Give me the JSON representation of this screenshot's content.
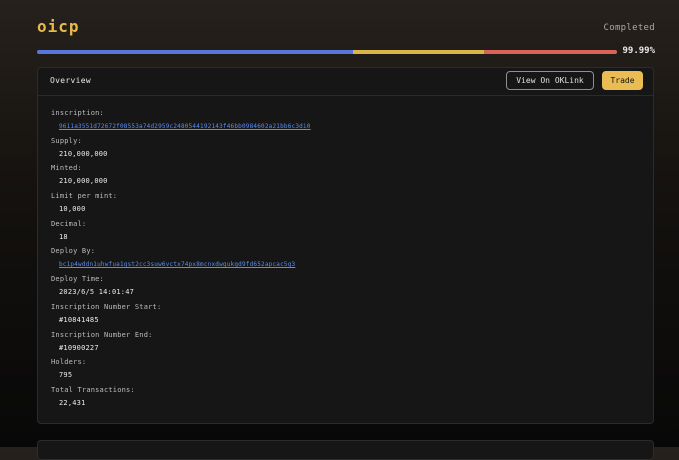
{
  "header": {
    "title": "oicp",
    "status": "Completed",
    "progress_percent": 99.99,
    "progress_label": "99.99%"
  },
  "card": {
    "title": "Overview",
    "oklink_button": "View On OKLink",
    "trade_button": "Trade"
  },
  "fields": [
    {
      "label": "inscription:",
      "value": "9611a3551d72672f08553a74d2959c2480544192143f46bb0984602a21bb6c3di0",
      "link": true
    },
    {
      "label": "Supply:",
      "value": "210,000,000",
      "link": false
    },
    {
      "label": "Minted:",
      "value": "210,000,000",
      "link": false
    },
    {
      "label": "Limit per mint:",
      "value": "10,000",
      "link": false
    },
    {
      "label": "Decimal:",
      "value": "18",
      "link": false
    },
    {
      "label": "Deploy By:",
      "value": "bc1p4wddn1uhwfua1qst2cc3suw6vctx74px8mcnxdwgukgd9fd652apcac5g3",
      "link": true
    },
    {
      "label": "Deploy Time:",
      "value": "2023/6/5 14:01:47",
      "link": false
    },
    {
      "label": "Inscription Number Start:",
      "value": "#10841485",
      "link": false
    },
    {
      "label": "Inscription Number End:",
      "value": "#10900227",
      "link": false
    },
    {
      "label": "Holders:",
      "value": "795",
      "link": false
    },
    {
      "label": "Total Transactions:",
      "value": "22,431",
      "link": false
    }
  ],
  "colors": {
    "accent": "#e9b94b",
    "progress_blue": "#5876d8",
    "progress_yellow": "#d9b64a",
    "progress_red": "#d86458",
    "link": "#5b8df5"
  }
}
